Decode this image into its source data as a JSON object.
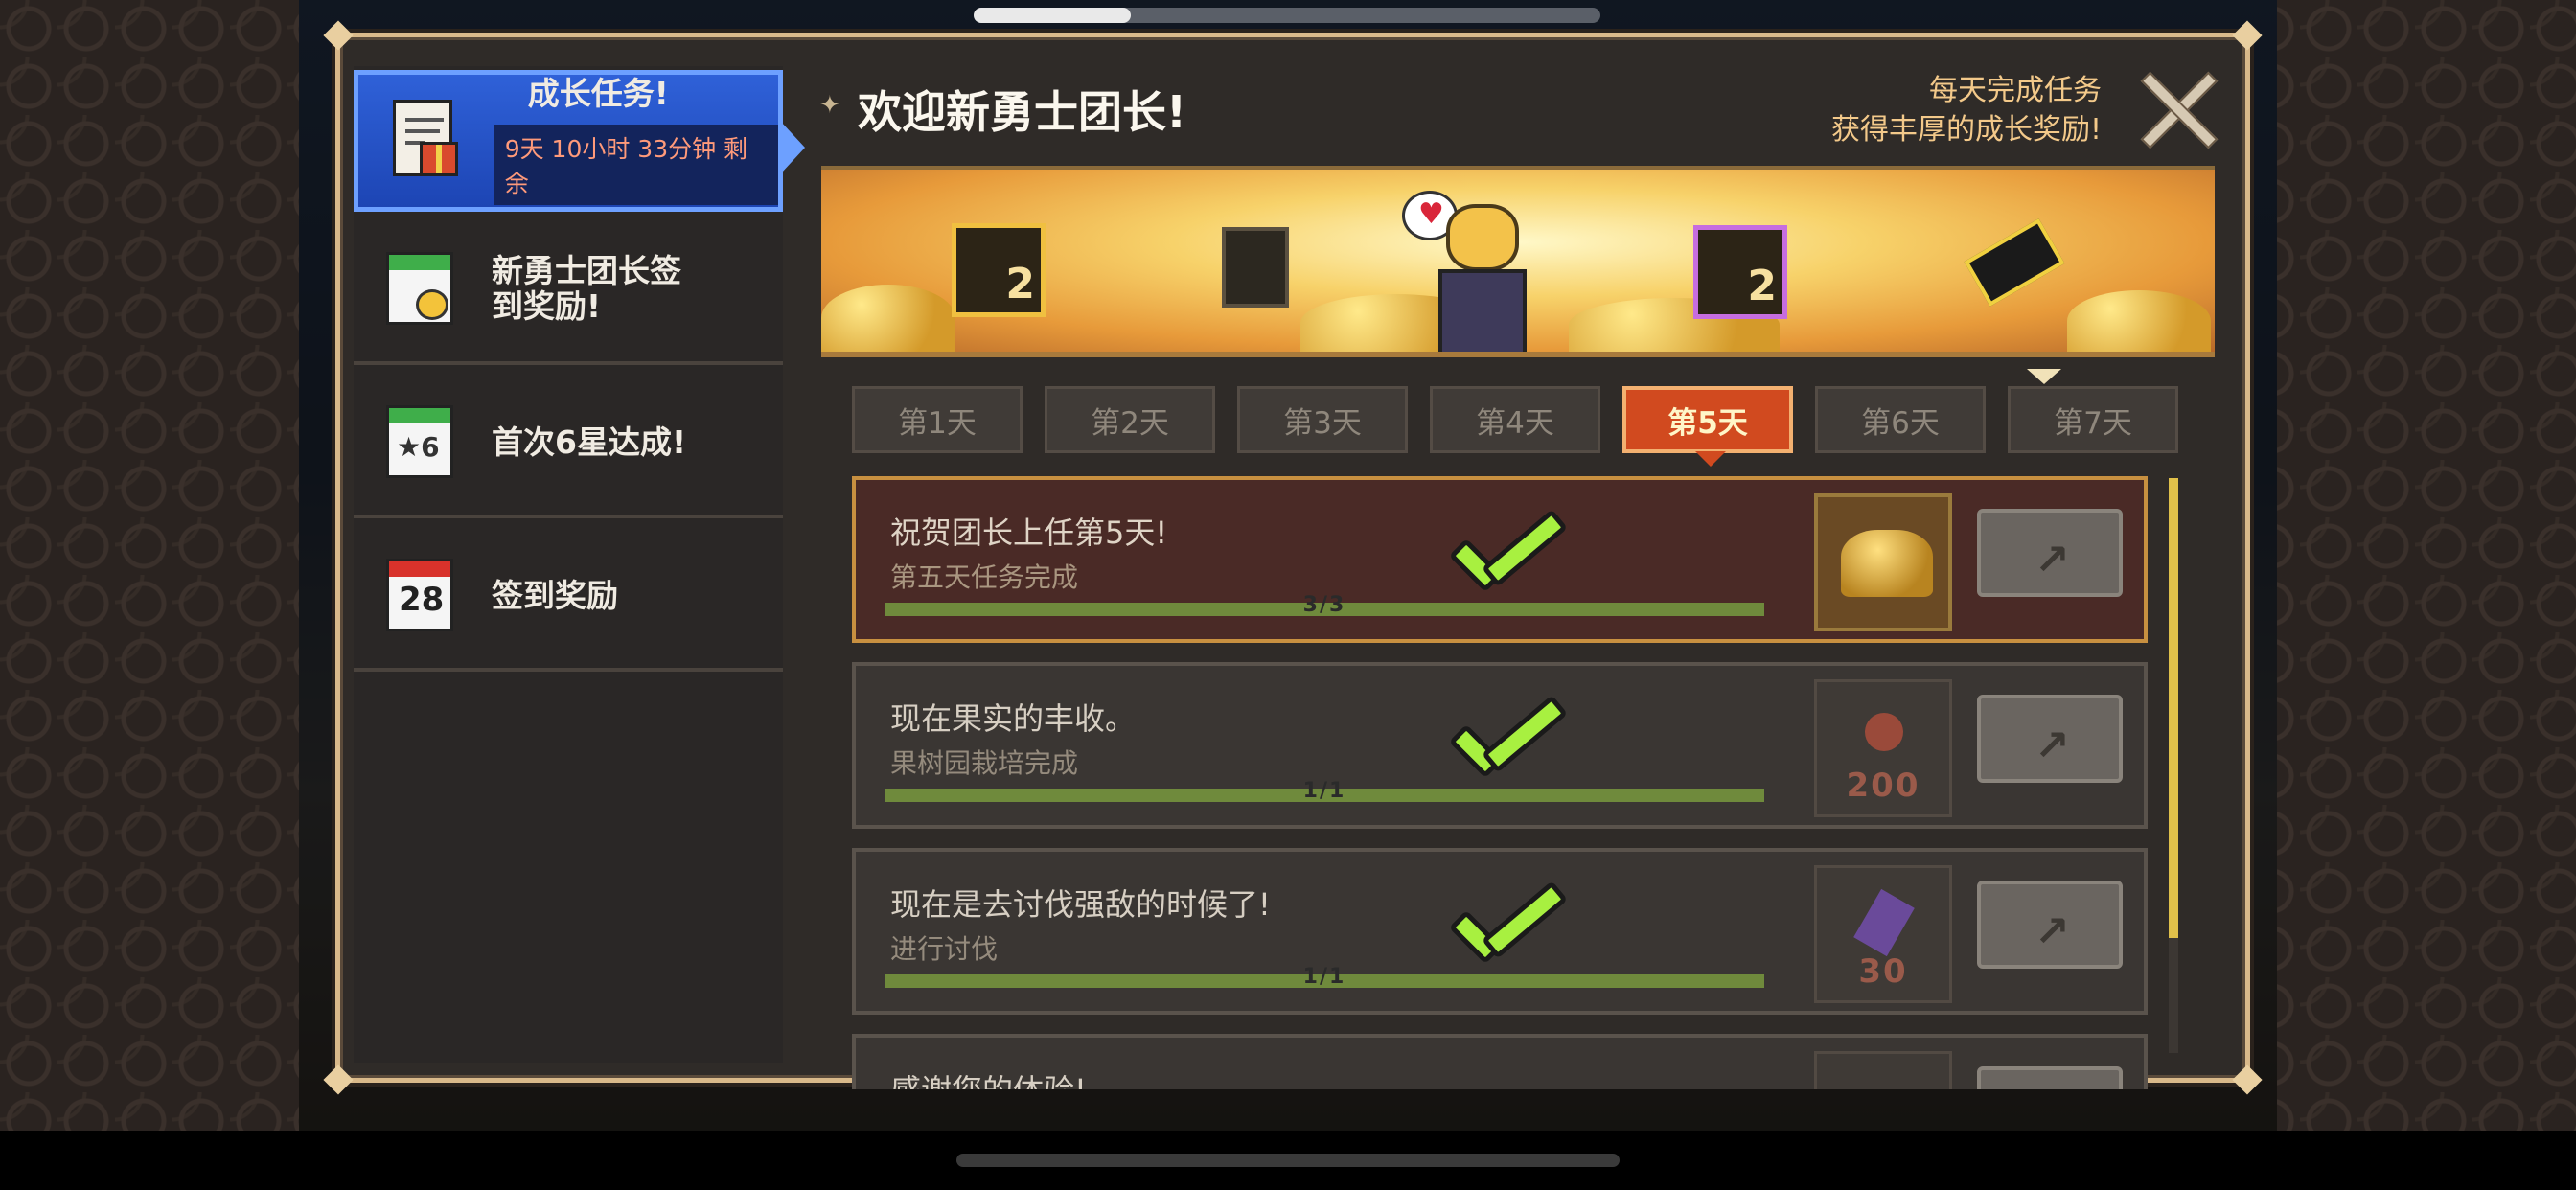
{
  "header": {
    "title": "欢迎新勇士团长!",
    "subtitle_line1": "每天完成任务",
    "subtitle_line2": "获得丰厚的成长奖励!"
  },
  "nav": {
    "items": [
      {
        "label": "成长任务!",
        "timer": "9天 10小时 33分钟 剩余",
        "active": true
      },
      {
        "label_line1": "新勇士团长签",
        "label_line2": "到奖励!"
      },
      {
        "label": "首次6星达成!",
        "icon_text": "★6"
      },
      {
        "label": "签到奖励",
        "icon_text": "28"
      }
    ]
  },
  "tabs": [
    "第1天",
    "第2天",
    "第3天",
    "第4天",
    "第5天",
    "第6天",
    "第7天"
  ],
  "active_tab": "第5天",
  "banner": {
    "icon1_num": "2",
    "icon2_num": "2"
  },
  "tasks": [
    {
      "title": "祝贺团长上任第5天!",
      "subtitle": "第五天任务完成",
      "progress_text": "3/3",
      "progress": 1.0,
      "reward_count": "",
      "completed": true
    },
    {
      "title": "现在果实的丰收。",
      "subtitle": "果树园栽培完成",
      "progress_text": "1/1",
      "progress": 1.0,
      "reward_count": "200",
      "completed": true
    },
    {
      "title": "现在是去讨伐强敌的时候了!",
      "subtitle": "进行讨伐",
      "progress_text": "1/1",
      "progress": 1.0,
      "reward_count": "30",
      "completed": true
    },
    {
      "title": "感谢您的体验!",
      "subtitle": "",
      "progress_text": "",
      "progress": 0,
      "reward_count": "",
      "completed": false
    }
  ],
  "colors": {
    "accent": "#d14a1f",
    "nav_active": "#2f61d8",
    "progress": "#6f8a3c",
    "check": "#a8f040",
    "frame": "#d9b98a"
  },
  "icons": [
    "document-gift-icon",
    "calendar-chick-icon",
    "calendar-star-icon",
    "calendar-date-icon",
    "close-icon",
    "go-arrow-icon",
    "checkmark-icon"
  ]
}
